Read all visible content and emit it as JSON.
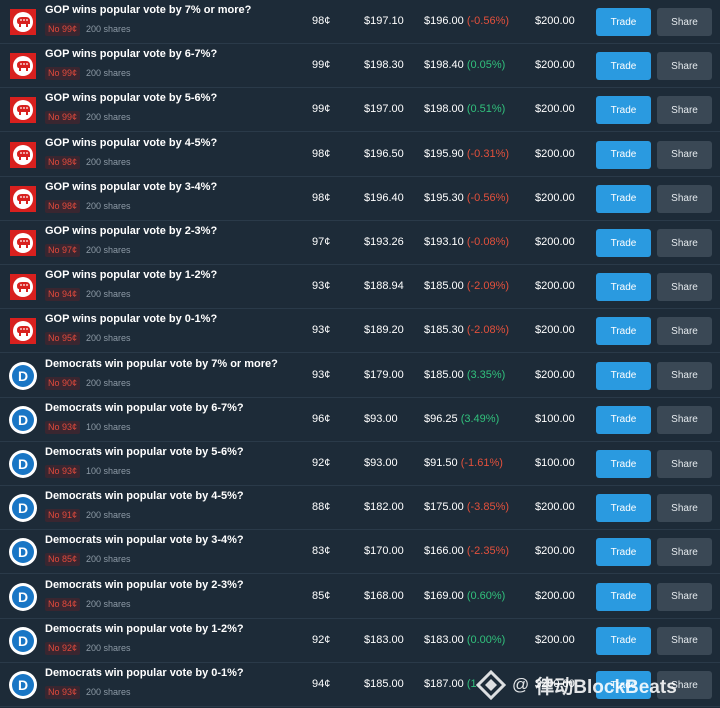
{
  "rows": [
    {
      "party": "gop",
      "title": "GOP wins popular vote by 7% or more?",
      "badge": "No 99¢",
      "shares": "200 shares",
      "price": "98¢",
      "cost": "$197.10",
      "value": "$196.00",
      "change": "(-0.56%)",
      "direction": "neg",
      "max": "$200.00",
      "trade": "Trade",
      "share": "Share"
    },
    {
      "party": "gop",
      "title": "GOP wins popular vote by 6-7%?",
      "badge": "No 99¢",
      "shares": "200 shares",
      "price": "99¢",
      "cost": "$198.30",
      "value": "$198.40",
      "change": "(0.05%)",
      "direction": "pos",
      "max": "$200.00",
      "trade": "Trade",
      "share": "Share"
    },
    {
      "party": "gop",
      "title": "GOP wins popular vote by 5-6%?",
      "badge": "No 99¢",
      "shares": "200 shares",
      "price": "99¢",
      "cost": "$197.00",
      "value": "$198.00",
      "change": "(0.51%)",
      "direction": "pos",
      "max": "$200.00",
      "trade": "Trade",
      "share": "Share"
    },
    {
      "party": "gop",
      "title": "GOP wins popular vote by 4-5%?",
      "badge": "No 98¢",
      "shares": "200 shares",
      "price": "98¢",
      "cost": "$196.50",
      "value": "$195.90",
      "change": "(-0.31%)",
      "direction": "neg",
      "max": "$200.00",
      "trade": "Trade",
      "share": "Share"
    },
    {
      "party": "gop",
      "title": "GOP wins popular vote by 3-4%?",
      "badge": "No 98¢",
      "shares": "200 shares",
      "price": "98¢",
      "cost": "$196.40",
      "value": "$195.30",
      "change": "(-0.56%)",
      "direction": "neg",
      "max": "$200.00",
      "trade": "Trade",
      "share": "Share"
    },
    {
      "party": "gop",
      "title": "GOP wins popular vote by 2-3%?",
      "badge": "No 97¢",
      "shares": "200 shares",
      "price": "97¢",
      "cost": "$193.26",
      "value": "$193.10",
      "change": "(-0.08%)",
      "direction": "neg",
      "max": "$200.00",
      "trade": "Trade",
      "share": "Share"
    },
    {
      "party": "gop",
      "title": "GOP wins popular vote by 1-2%?",
      "badge": "No 94¢",
      "shares": "200 shares",
      "price": "93¢",
      "cost": "$188.94",
      "value": "$185.00",
      "change": "(-2.09%)",
      "direction": "neg",
      "max": "$200.00",
      "trade": "Trade",
      "share": "Share"
    },
    {
      "party": "gop",
      "title": "GOP wins popular vote by 0-1%?",
      "badge": "No 95¢",
      "shares": "200 shares",
      "price": "93¢",
      "cost": "$189.20",
      "value": "$185.30",
      "change": "(-2.08%)",
      "direction": "neg",
      "max": "$200.00",
      "trade": "Trade",
      "share": "Share"
    },
    {
      "party": "dem",
      "title": "Democrats win popular vote by 7% or more?",
      "badge": "No 90¢",
      "shares": "200 shares",
      "price": "93¢",
      "cost": "$179.00",
      "value": "$185.00",
      "change": "(3.35%)",
      "direction": "pos",
      "max": "$200.00",
      "trade": "Trade",
      "share": "Share"
    },
    {
      "party": "dem",
      "title": "Democrats win popular vote by 6-7%?",
      "badge": "No 93¢",
      "shares": "100 shares",
      "price": "96¢",
      "cost": "$93.00",
      "value": "$96.25",
      "change": "(3.49%)",
      "direction": "pos",
      "max": "$100.00",
      "trade": "Trade",
      "share": "Share"
    },
    {
      "party": "dem",
      "title": "Democrats win popular vote by 5-6%?",
      "badge": "No 93¢",
      "shares": "100 shares",
      "price": "92¢",
      "cost": "$93.00",
      "value": "$91.50",
      "change": "(-1.61%)",
      "direction": "neg",
      "max": "$100.00",
      "trade": "Trade",
      "share": "Share"
    },
    {
      "party": "dem",
      "title": "Democrats win popular vote by 4-5%?",
      "badge": "No 91¢",
      "shares": "200 shares",
      "price": "88¢",
      "cost": "$182.00",
      "value": "$175.00",
      "change": "(-3.85%)",
      "direction": "neg",
      "max": "$200.00",
      "trade": "Trade",
      "share": "Share"
    },
    {
      "party": "dem",
      "title": "Democrats win popular vote by 3-4%?",
      "badge": "No 85¢",
      "shares": "200 shares",
      "price": "83¢",
      "cost": "$170.00",
      "value": "$166.00",
      "change": "(-2.35%)",
      "direction": "neg",
      "max": "$200.00",
      "trade": "Trade",
      "share": "Share"
    },
    {
      "party": "dem",
      "title": "Democrats win popular vote by 2-3%?",
      "badge": "No 84¢",
      "shares": "200 shares",
      "price": "85¢",
      "cost": "$168.00",
      "value": "$169.00",
      "change": "(0.60%)",
      "direction": "pos",
      "max": "$200.00",
      "trade": "Trade",
      "share": "Share"
    },
    {
      "party": "dem",
      "title": "Democrats win popular vote by 1-2%?",
      "badge": "No 92¢",
      "shares": "200 shares",
      "price": "92¢",
      "cost": "$183.00",
      "value": "$183.00",
      "change": "(0.00%)",
      "direction": "pos",
      "max": "$200.00",
      "trade": "Trade",
      "share": "Share"
    },
    {
      "party": "dem",
      "title": "Democrats win popular vote by 0-1%?",
      "badge": "No 93¢",
      "shares": "200 shares",
      "price": "94¢",
      "cost": "$185.00",
      "value": "$187.00",
      "change": "(1.",
      "direction": "pos",
      "max": "$200.00",
      "trade": "Trade",
      "share": "Share"
    }
  ],
  "watermark": {
    "at": "@",
    "text": "律动BlockBeats"
  },
  "colors": {
    "gop": "#d8201e",
    "dem": "#1976c5",
    "trade": "#2a9ae0",
    "negative": "#e2503c",
    "positive": "#31c07c"
  }
}
